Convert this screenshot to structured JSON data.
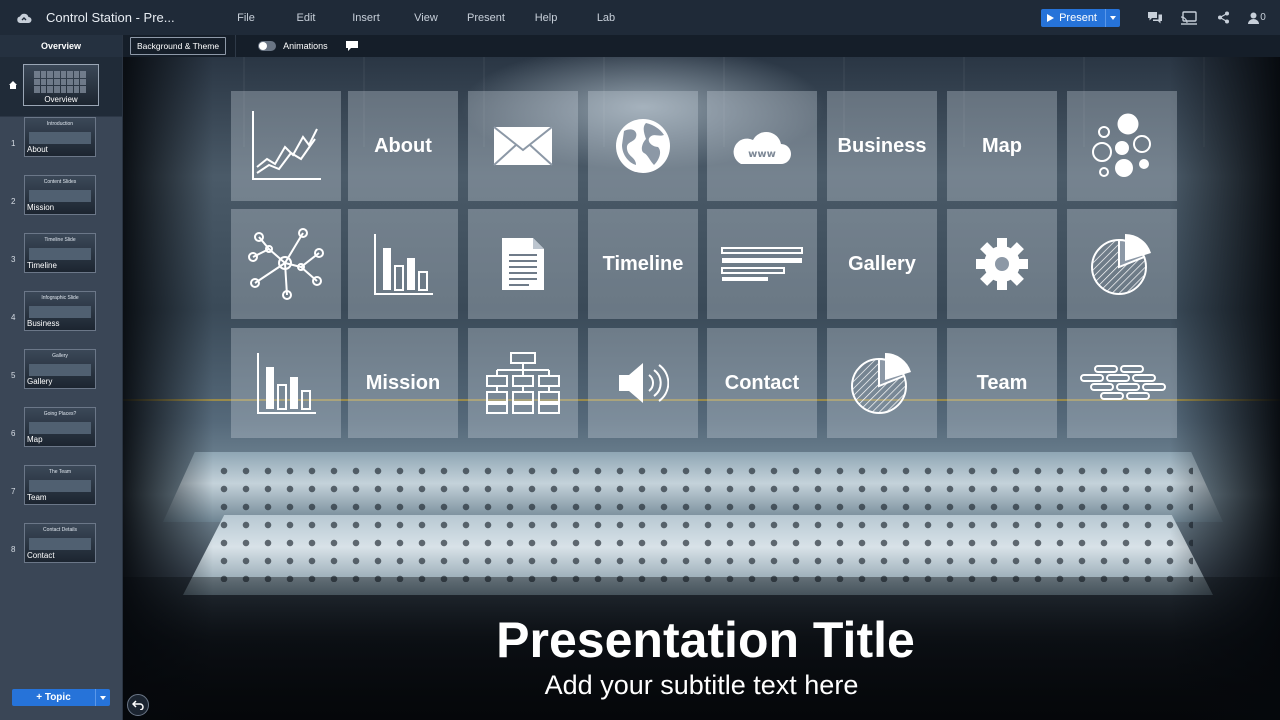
{
  "app": {
    "doc_title": "Control Station - Pre...",
    "menu": [
      "File",
      "Edit",
      "Insert",
      "View",
      "Present",
      "Help",
      "Lab"
    ],
    "present_label": "Present",
    "collaborator_count": "0",
    "accent": "#2673d9"
  },
  "subbar": {
    "background_theme_label": "Background & Theme",
    "animations_label": "Animations"
  },
  "sidebar": {
    "header": "Overview",
    "overview_thumb_label": "Overview",
    "slides": [
      {
        "num": "1",
        "label": "About",
        "title": "Introduction"
      },
      {
        "num": "2",
        "label": "Mission",
        "title": "Content Slides"
      },
      {
        "num": "3",
        "label": "Timeline",
        "title": "Timeline Slide"
      },
      {
        "num": "4",
        "label": "Business",
        "title": "Infographic Slide"
      },
      {
        "num": "5",
        "label": "Gallery",
        "title": "Gallery"
      },
      {
        "num": "6",
        "label": "Map",
        "title": "Going Places?"
      },
      {
        "num": "7",
        "label": "Team",
        "title": "The Team"
      },
      {
        "num": "8",
        "label": "Contact",
        "title": "Contact Details"
      }
    ],
    "topic_label": "+ Topic"
  },
  "canvas": {
    "tiles": [
      {
        "type": "icon",
        "icon": "line-chart-icon"
      },
      {
        "type": "text",
        "label": "About"
      },
      {
        "type": "icon",
        "icon": "envelope-icon"
      },
      {
        "type": "icon",
        "icon": "globe-icon"
      },
      {
        "type": "icon",
        "icon": "cloud-www-icon",
        "icon_text": "www"
      },
      {
        "type": "text",
        "label": "Business"
      },
      {
        "type": "text",
        "label": "Map"
      },
      {
        "type": "icon",
        "icon": "bubbles-icon"
      },
      {
        "type": "icon",
        "icon": "network-icon"
      },
      {
        "type": "icon",
        "icon": "bar-chart-icon"
      },
      {
        "type": "icon",
        "icon": "document-icon"
      },
      {
        "type": "text",
        "label": "Timeline"
      },
      {
        "type": "icon",
        "icon": "text-lines-icon"
      },
      {
        "type": "text",
        "label": "Gallery"
      },
      {
        "type": "icon",
        "icon": "gear-icon"
      },
      {
        "type": "icon",
        "icon": "pie-chart-icon"
      },
      {
        "type": "icon",
        "icon": "bar-chart-icon"
      },
      {
        "type": "text",
        "label": "Mission"
      },
      {
        "type": "icon",
        "icon": "org-chart-icon"
      },
      {
        "type": "icon",
        "icon": "speaker-icon"
      },
      {
        "type": "text",
        "label": "Contact"
      },
      {
        "type": "icon",
        "icon": "pie-chart-icon"
      },
      {
        "type": "text",
        "label": "Team"
      },
      {
        "type": "icon",
        "icon": "brick-wall-icon"
      }
    ],
    "title": "Presentation Title",
    "subtitle": "Add your subtitle text here"
  }
}
